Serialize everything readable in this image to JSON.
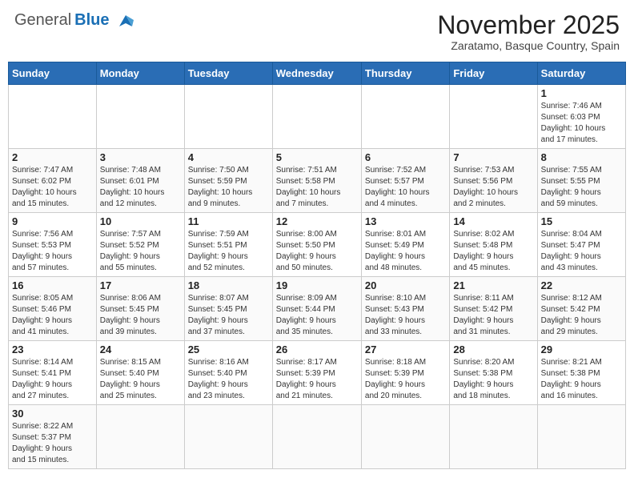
{
  "header": {
    "logo_general": "General",
    "logo_blue": "Blue",
    "month_title": "November 2025",
    "location": "Zaratamo, Basque Country, Spain"
  },
  "days_of_week": [
    "Sunday",
    "Monday",
    "Tuesday",
    "Wednesday",
    "Thursday",
    "Friday",
    "Saturday"
  ],
  "weeks": [
    [
      {
        "day": "",
        "info": ""
      },
      {
        "day": "",
        "info": ""
      },
      {
        "day": "",
        "info": ""
      },
      {
        "day": "",
        "info": ""
      },
      {
        "day": "",
        "info": ""
      },
      {
        "day": "",
        "info": ""
      },
      {
        "day": "1",
        "info": "Sunrise: 7:46 AM\nSunset: 6:03 PM\nDaylight: 10 hours\nand 17 minutes."
      }
    ],
    [
      {
        "day": "2",
        "info": "Sunrise: 7:47 AM\nSunset: 6:02 PM\nDaylight: 10 hours\nand 15 minutes."
      },
      {
        "day": "3",
        "info": "Sunrise: 7:48 AM\nSunset: 6:01 PM\nDaylight: 10 hours\nand 12 minutes."
      },
      {
        "day": "4",
        "info": "Sunrise: 7:50 AM\nSunset: 5:59 PM\nDaylight: 10 hours\nand 9 minutes."
      },
      {
        "day": "5",
        "info": "Sunrise: 7:51 AM\nSunset: 5:58 PM\nDaylight: 10 hours\nand 7 minutes."
      },
      {
        "day": "6",
        "info": "Sunrise: 7:52 AM\nSunset: 5:57 PM\nDaylight: 10 hours\nand 4 minutes."
      },
      {
        "day": "7",
        "info": "Sunrise: 7:53 AM\nSunset: 5:56 PM\nDaylight: 10 hours\nand 2 minutes."
      },
      {
        "day": "8",
        "info": "Sunrise: 7:55 AM\nSunset: 5:55 PM\nDaylight: 9 hours\nand 59 minutes."
      }
    ],
    [
      {
        "day": "9",
        "info": "Sunrise: 7:56 AM\nSunset: 5:53 PM\nDaylight: 9 hours\nand 57 minutes."
      },
      {
        "day": "10",
        "info": "Sunrise: 7:57 AM\nSunset: 5:52 PM\nDaylight: 9 hours\nand 55 minutes."
      },
      {
        "day": "11",
        "info": "Sunrise: 7:59 AM\nSunset: 5:51 PM\nDaylight: 9 hours\nand 52 minutes."
      },
      {
        "day": "12",
        "info": "Sunrise: 8:00 AM\nSunset: 5:50 PM\nDaylight: 9 hours\nand 50 minutes."
      },
      {
        "day": "13",
        "info": "Sunrise: 8:01 AM\nSunset: 5:49 PM\nDaylight: 9 hours\nand 48 minutes."
      },
      {
        "day": "14",
        "info": "Sunrise: 8:02 AM\nSunset: 5:48 PM\nDaylight: 9 hours\nand 45 minutes."
      },
      {
        "day": "15",
        "info": "Sunrise: 8:04 AM\nSunset: 5:47 PM\nDaylight: 9 hours\nand 43 minutes."
      }
    ],
    [
      {
        "day": "16",
        "info": "Sunrise: 8:05 AM\nSunset: 5:46 PM\nDaylight: 9 hours\nand 41 minutes."
      },
      {
        "day": "17",
        "info": "Sunrise: 8:06 AM\nSunset: 5:45 PM\nDaylight: 9 hours\nand 39 minutes."
      },
      {
        "day": "18",
        "info": "Sunrise: 8:07 AM\nSunset: 5:45 PM\nDaylight: 9 hours\nand 37 minutes."
      },
      {
        "day": "19",
        "info": "Sunrise: 8:09 AM\nSunset: 5:44 PM\nDaylight: 9 hours\nand 35 minutes."
      },
      {
        "day": "20",
        "info": "Sunrise: 8:10 AM\nSunset: 5:43 PM\nDaylight: 9 hours\nand 33 minutes."
      },
      {
        "day": "21",
        "info": "Sunrise: 8:11 AM\nSunset: 5:42 PM\nDaylight: 9 hours\nand 31 minutes."
      },
      {
        "day": "22",
        "info": "Sunrise: 8:12 AM\nSunset: 5:42 PM\nDaylight: 9 hours\nand 29 minutes."
      }
    ],
    [
      {
        "day": "23",
        "info": "Sunrise: 8:14 AM\nSunset: 5:41 PM\nDaylight: 9 hours\nand 27 minutes."
      },
      {
        "day": "24",
        "info": "Sunrise: 8:15 AM\nSunset: 5:40 PM\nDaylight: 9 hours\nand 25 minutes."
      },
      {
        "day": "25",
        "info": "Sunrise: 8:16 AM\nSunset: 5:40 PM\nDaylight: 9 hours\nand 23 minutes."
      },
      {
        "day": "26",
        "info": "Sunrise: 8:17 AM\nSunset: 5:39 PM\nDaylight: 9 hours\nand 21 minutes."
      },
      {
        "day": "27",
        "info": "Sunrise: 8:18 AM\nSunset: 5:39 PM\nDaylight: 9 hours\nand 20 minutes."
      },
      {
        "day": "28",
        "info": "Sunrise: 8:20 AM\nSunset: 5:38 PM\nDaylight: 9 hours\nand 18 minutes."
      },
      {
        "day": "29",
        "info": "Sunrise: 8:21 AM\nSunset: 5:38 PM\nDaylight: 9 hours\nand 16 minutes."
      }
    ],
    [
      {
        "day": "30",
        "info": "Sunrise: 8:22 AM\nSunset: 5:37 PM\nDaylight: 9 hours\nand 15 minutes."
      },
      {
        "day": "",
        "info": ""
      },
      {
        "day": "",
        "info": ""
      },
      {
        "day": "",
        "info": ""
      },
      {
        "day": "",
        "info": ""
      },
      {
        "day": "",
        "info": ""
      },
      {
        "day": "",
        "info": ""
      }
    ]
  ]
}
